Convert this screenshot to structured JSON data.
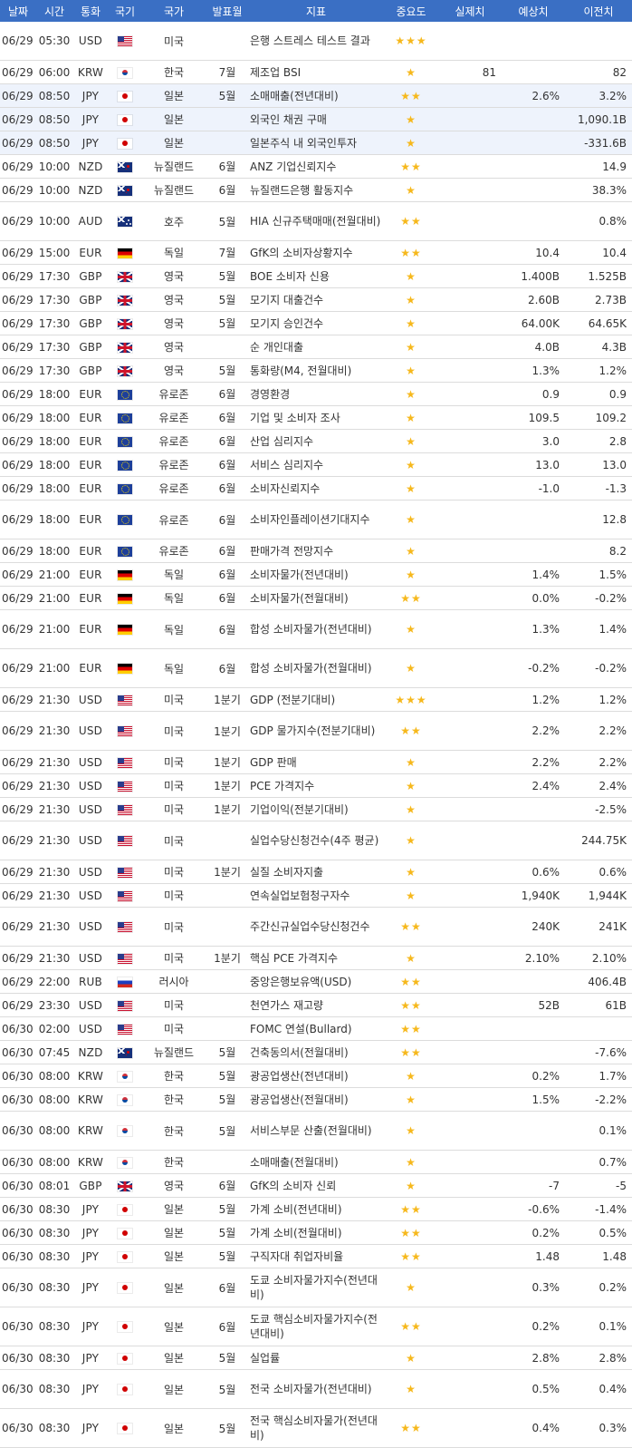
{
  "header": {
    "date": "날짜",
    "time": "시간",
    "currency": "통화",
    "flag": "국기",
    "country": "국가",
    "period": "발표월",
    "indicator": "지표",
    "importance": "중요도",
    "actual": "실제치",
    "forecast": "예상치",
    "previous": "이전치"
  },
  "colors": {
    "header_bg": "#3a6fc4",
    "star": "#f6b81c",
    "highlight_row": "#eef3fc"
  },
  "rows": [
    {
      "date": "06/29",
      "time": "05:30",
      "cur": "USD",
      "flag": "us",
      "country": "미국",
      "period": "",
      "indicator": "은행 스트레스 테스트 결과",
      "stars": "★★★",
      "actual": "",
      "forecast": "",
      "previous": "",
      "tall": true
    },
    {
      "date": "06/29",
      "time": "06:00",
      "cur": "KRW",
      "flag": "kr",
      "country": "한국",
      "period": "7월",
      "indicator": "제조업 BSI",
      "stars": "★",
      "actual": "81",
      "forecast": "",
      "previous": "82"
    },
    {
      "date": "06/29",
      "time": "08:50",
      "cur": "JPY",
      "flag": "jp",
      "country": "일본",
      "period": "5월",
      "indicator": "소매매출(전년대비)",
      "stars": "★★",
      "actual": "",
      "forecast": "2.6%",
      "previous": "3.2%",
      "hl": true
    },
    {
      "date": "06/29",
      "time": "08:50",
      "cur": "JPY",
      "flag": "jp",
      "country": "일본",
      "period": "",
      "indicator": "외국인 채권 구매",
      "stars": "★",
      "actual": "",
      "forecast": "",
      "previous": "1,090.1B",
      "hl": true
    },
    {
      "date": "06/29",
      "time": "08:50",
      "cur": "JPY",
      "flag": "jp",
      "country": "일본",
      "period": "",
      "indicator": "일본주식 내 외국인투자",
      "stars": "★",
      "actual": "",
      "forecast": "",
      "previous": "-331.6B",
      "hl": true
    },
    {
      "date": "06/29",
      "time": "10:00",
      "cur": "NZD",
      "flag": "nz",
      "country": "뉴질랜드",
      "period": "6월",
      "indicator": "ANZ 기업신뢰지수",
      "stars": "★★",
      "actual": "",
      "forecast": "",
      "previous": "14.9"
    },
    {
      "date": "06/29",
      "time": "10:00",
      "cur": "NZD",
      "flag": "nz",
      "country": "뉴질랜드",
      "period": "6월",
      "indicator": "뉴질랜드은행 활동지수",
      "stars": "★",
      "actual": "",
      "forecast": "",
      "previous": "38.3%"
    },
    {
      "date": "06/29",
      "time": "10:00",
      "cur": "AUD",
      "flag": "au",
      "country": "호주",
      "period": "5월",
      "indicator": "HIA 신규주택매매(전월대비)",
      "stars": "★★",
      "actual": "",
      "forecast": "",
      "previous": "0.8%",
      "tall": true
    },
    {
      "date": "06/29",
      "time": "15:00",
      "cur": "EUR",
      "flag": "de",
      "country": "독일",
      "period": "7월",
      "indicator": "GfK의 소비자상황지수",
      "stars": "★★",
      "actual": "",
      "forecast": "10.4",
      "previous": "10.4"
    },
    {
      "date": "06/29",
      "time": "17:30",
      "cur": "GBP",
      "flag": "gb",
      "country": "영국",
      "period": "5월",
      "indicator": "BOE 소비자 신용",
      "stars": "★",
      "actual": "",
      "forecast": "1.400B",
      "previous": "1.525B"
    },
    {
      "date": "06/29",
      "time": "17:30",
      "cur": "GBP",
      "flag": "gb",
      "country": "영국",
      "period": "5월",
      "indicator": "모기지 대출건수",
      "stars": "★",
      "actual": "",
      "forecast": "2.60B",
      "previous": "2.73B"
    },
    {
      "date": "06/29",
      "time": "17:30",
      "cur": "GBP",
      "flag": "gb",
      "country": "영국",
      "period": "5월",
      "indicator": "모기지 승인건수",
      "stars": "★",
      "actual": "",
      "forecast": "64.00K",
      "previous": "64.65K"
    },
    {
      "date": "06/29",
      "time": "17:30",
      "cur": "GBP",
      "flag": "gb",
      "country": "영국",
      "period": "",
      "indicator": "순 개인대출",
      "stars": "★",
      "actual": "",
      "forecast": "4.0B",
      "previous": "4.3B"
    },
    {
      "date": "06/29",
      "time": "17:30",
      "cur": "GBP",
      "flag": "gb",
      "country": "영국",
      "period": "5월",
      "indicator": "통화량(M4, 전월대비)",
      "stars": "★",
      "actual": "",
      "forecast": "1.3%",
      "previous": "1.2%"
    },
    {
      "date": "06/29",
      "time": "18:00",
      "cur": "EUR",
      "flag": "eu",
      "country": "유로존",
      "period": "6월",
      "indicator": "경영환경",
      "stars": "★",
      "actual": "",
      "forecast": "0.9",
      "previous": "0.9"
    },
    {
      "date": "06/29",
      "time": "18:00",
      "cur": "EUR",
      "flag": "eu",
      "country": "유로존",
      "period": "6월",
      "indicator": "기업 및 소비자 조사",
      "stars": "★",
      "actual": "",
      "forecast": "109.5",
      "previous": "109.2"
    },
    {
      "date": "06/29",
      "time": "18:00",
      "cur": "EUR",
      "flag": "eu",
      "country": "유로존",
      "period": "6월",
      "indicator": "산업 심리지수",
      "stars": "★",
      "actual": "",
      "forecast": "3.0",
      "previous": "2.8"
    },
    {
      "date": "06/29",
      "time": "18:00",
      "cur": "EUR",
      "flag": "eu",
      "country": "유로존",
      "period": "6월",
      "indicator": "서비스 심리지수",
      "stars": "★",
      "actual": "",
      "forecast": "13.0",
      "previous": "13.0"
    },
    {
      "date": "06/29",
      "time": "18:00",
      "cur": "EUR",
      "flag": "eu",
      "country": "유로존",
      "period": "6월",
      "indicator": "소비자신뢰지수",
      "stars": "★",
      "actual": "",
      "forecast": "-1.0",
      "previous": "-1.3"
    },
    {
      "date": "06/29",
      "time": "18:00",
      "cur": "EUR",
      "flag": "eu",
      "country": "유로존",
      "period": "6월",
      "indicator": "소비자인플레이션기대지수",
      "stars": "★",
      "actual": "",
      "forecast": "",
      "previous": "12.8",
      "tall": true
    },
    {
      "date": "06/29",
      "time": "18:00",
      "cur": "EUR",
      "flag": "eu",
      "country": "유로존",
      "period": "6월",
      "indicator": "판매가격 전망지수",
      "stars": "★",
      "actual": "",
      "forecast": "",
      "previous": "8.2"
    },
    {
      "date": "06/29",
      "time": "21:00",
      "cur": "EUR",
      "flag": "de",
      "country": "독일",
      "period": "6월",
      "indicator": "소비자물가(전년대비)",
      "stars": "★",
      "actual": "",
      "forecast": "1.4%",
      "previous": "1.5%"
    },
    {
      "date": "06/29",
      "time": "21:00",
      "cur": "EUR",
      "flag": "de",
      "country": "독일",
      "period": "6월",
      "indicator": "소비자물가(전월대비)",
      "stars": "★★",
      "actual": "",
      "forecast": "0.0%",
      "previous": "-0.2%"
    },
    {
      "date": "06/29",
      "time": "21:00",
      "cur": "EUR",
      "flag": "de",
      "country": "독일",
      "period": "6월",
      "indicator": "합성 소비자물가(전년대비)",
      "stars": "★",
      "actual": "",
      "forecast": "1.3%",
      "previous": "1.4%",
      "tall": true
    },
    {
      "date": "06/29",
      "time": "21:00",
      "cur": "EUR",
      "flag": "de",
      "country": "독일",
      "period": "6월",
      "indicator": "합성 소비자물가(전월대비)",
      "stars": "★",
      "actual": "",
      "forecast": "-0.2%",
      "previous": "-0.2%",
      "tall": true
    },
    {
      "date": "06/29",
      "time": "21:30",
      "cur": "USD",
      "flag": "us",
      "country": "미국",
      "period": "1분기",
      "indicator": "GDP (전분기대비)",
      "stars": "★★★",
      "actual": "",
      "forecast": "1.2%",
      "previous": "1.2%"
    },
    {
      "date": "06/29",
      "time": "21:30",
      "cur": "USD",
      "flag": "us",
      "country": "미국",
      "period": "1분기",
      "indicator": "GDP 물가지수(전분기대비)",
      "stars": "★★",
      "actual": "",
      "forecast": "2.2%",
      "previous": "2.2%",
      "tall": true
    },
    {
      "date": "06/29",
      "time": "21:30",
      "cur": "USD",
      "flag": "us",
      "country": "미국",
      "period": "1분기",
      "indicator": "GDP 판매",
      "stars": "★",
      "actual": "",
      "forecast": "2.2%",
      "previous": "2.2%"
    },
    {
      "date": "06/29",
      "time": "21:30",
      "cur": "USD",
      "flag": "us",
      "country": "미국",
      "period": "1분기",
      "indicator": "PCE 가격지수",
      "stars": "★",
      "actual": "",
      "forecast": "2.4%",
      "previous": "2.4%"
    },
    {
      "date": "06/29",
      "time": "21:30",
      "cur": "USD",
      "flag": "us",
      "country": "미국",
      "period": "1분기",
      "indicator": "기업이익(전분기대비)",
      "stars": "★",
      "actual": "",
      "forecast": "",
      "previous": "-2.5%"
    },
    {
      "date": "06/29",
      "time": "21:30",
      "cur": "USD",
      "flag": "us",
      "country": "미국",
      "period": "",
      "indicator": "실업수당신청건수(4주 평균)",
      "stars": "★",
      "actual": "",
      "forecast": "",
      "previous": "244.75K",
      "tall": true
    },
    {
      "date": "06/29",
      "time": "21:30",
      "cur": "USD",
      "flag": "us",
      "country": "미국",
      "period": "1분기",
      "indicator": "실질 소비자지출",
      "stars": "★",
      "actual": "",
      "forecast": "0.6%",
      "previous": "0.6%"
    },
    {
      "date": "06/29",
      "time": "21:30",
      "cur": "USD",
      "flag": "us",
      "country": "미국",
      "period": "",
      "indicator": "연속실업보험청구자수",
      "stars": "★",
      "actual": "",
      "forecast": "1,940K",
      "previous": "1,944K"
    },
    {
      "date": "06/29",
      "time": "21:30",
      "cur": "USD",
      "flag": "us",
      "country": "미국",
      "period": "",
      "indicator": "주간신규실업수당신청건수",
      "stars": "★★",
      "actual": "",
      "forecast": "240K",
      "previous": "241K",
      "tall": true
    },
    {
      "date": "06/29",
      "time": "21:30",
      "cur": "USD",
      "flag": "us",
      "country": "미국",
      "period": "1분기",
      "indicator": "핵심 PCE 가격지수",
      "stars": "★",
      "actual": "",
      "forecast": "2.10%",
      "previous": "2.10%"
    },
    {
      "date": "06/29",
      "time": "22:00",
      "cur": "RUB",
      "flag": "ru",
      "country": "러시아",
      "period": "",
      "indicator": "중앙은행보유액(USD)",
      "stars": "★★",
      "actual": "",
      "forecast": "",
      "previous": "406.4B"
    },
    {
      "date": "06/29",
      "time": "23:30",
      "cur": "USD",
      "flag": "us",
      "country": "미국",
      "period": "",
      "indicator": "천연가스 재고량",
      "stars": "★★",
      "actual": "",
      "forecast": "52B",
      "previous": "61B"
    },
    {
      "date": "06/30",
      "time": "02:00",
      "cur": "USD",
      "flag": "us",
      "country": "미국",
      "period": "",
      "indicator": "FOMC 연설(Bullard)",
      "stars": "★★",
      "actual": "",
      "forecast": "",
      "previous": ""
    },
    {
      "date": "06/30",
      "time": "07:45",
      "cur": "NZD",
      "flag": "nz",
      "country": "뉴질랜드",
      "period": "5월",
      "indicator": "건축동의서(전월대비)",
      "stars": "★★",
      "actual": "",
      "forecast": "",
      "previous": "-7.6%"
    },
    {
      "date": "06/30",
      "time": "08:00",
      "cur": "KRW",
      "flag": "kr",
      "country": "한국",
      "period": "5월",
      "indicator": "광공업생산(전년대비)",
      "stars": "★",
      "actual": "",
      "forecast": "0.2%",
      "previous": "1.7%"
    },
    {
      "date": "06/30",
      "time": "08:00",
      "cur": "KRW",
      "flag": "kr",
      "country": "한국",
      "period": "5월",
      "indicator": "광공업생산(전월대비)",
      "stars": "★",
      "actual": "",
      "forecast": "1.5%",
      "previous": "-2.2%"
    },
    {
      "date": "06/30",
      "time": "08:00",
      "cur": "KRW",
      "flag": "kr",
      "country": "한국",
      "period": "5월",
      "indicator": "서비스부문 산출(전월대비)",
      "stars": "★",
      "actual": "",
      "forecast": "",
      "previous": "0.1%",
      "tall": true
    },
    {
      "date": "06/30",
      "time": "08:00",
      "cur": "KRW",
      "flag": "kr",
      "country": "한국",
      "period": "",
      "indicator": "소매매출(전월대비)",
      "stars": "★",
      "actual": "",
      "forecast": "",
      "previous": "0.7%"
    },
    {
      "date": "06/30",
      "time": "08:01",
      "cur": "GBP",
      "flag": "gb",
      "country": "영국",
      "period": "6월",
      "indicator": "GfK의 소비자 신뢰",
      "stars": "★",
      "actual": "",
      "forecast": "-7",
      "previous": "-5"
    },
    {
      "date": "06/30",
      "time": "08:30",
      "cur": "JPY",
      "flag": "jp",
      "country": "일본",
      "period": "5월",
      "indicator": "가계 소비(전년대비)",
      "stars": "★★",
      "actual": "",
      "forecast": "-0.6%",
      "previous": "-1.4%"
    },
    {
      "date": "06/30",
      "time": "08:30",
      "cur": "JPY",
      "flag": "jp",
      "country": "일본",
      "period": "5월",
      "indicator": "가계 소비(전월대비)",
      "stars": "★★",
      "actual": "",
      "forecast": "0.2%",
      "previous": "0.5%"
    },
    {
      "date": "06/30",
      "time": "08:30",
      "cur": "JPY",
      "flag": "jp",
      "country": "일본",
      "period": "5월",
      "indicator": "구직자대 취업자비율",
      "stars": "★★",
      "actual": "",
      "forecast": "1.48",
      "previous": "1.48"
    },
    {
      "date": "06/30",
      "time": "08:30",
      "cur": "JPY",
      "flag": "jp",
      "country": "일본",
      "period": "6월",
      "indicator": "도쿄 소비자물가지수(전년대비)",
      "stars": "★",
      "actual": "",
      "forecast": "0.3%",
      "previous": "0.2%",
      "tall": true
    },
    {
      "date": "06/30",
      "time": "08:30",
      "cur": "JPY",
      "flag": "jp",
      "country": "일본",
      "period": "6월",
      "indicator": "도쿄 핵심소비자물가지수(전년대비)",
      "stars": "★★",
      "actual": "",
      "forecast": "0.2%",
      "previous": "0.1%",
      "tall": true
    },
    {
      "date": "06/30",
      "time": "08:30",
      "cur": "JPY",
      "flag": "jp",
      "country": "일본",
      "period": "5월",
      "indicator": "실업률",
      "stars": "★",
      "actual": "",
      "forecast": "2.8%",
      "previous": "2.8%"
    },
    {
      "date": "06/30",
      "time": "08:30",
      "cur": "JPY",
      "flag": "jp",
      "country": "일본",
      "period": "5월",
      "indicator": "전국 소비자물가(전년대비)",
      "stars": "★",
      "actual": "",
      "forecast": "0.5%",
      "previous": "0.4%",
      "tall": true
    },
    {
      "date": "06/30",
      "time": "08:30",
      "cur": "JPY",
      "flag": "jp",
      "country": "일본",
      "period": "5월",
      "indicator": "전국 핵심소비자물가(전년대비)",
      "stars": "★★",
      "actual": "",
      "forecast": "0.4%",
      "previous": "0.3%",
      "tall": true
    }
  ]
}
